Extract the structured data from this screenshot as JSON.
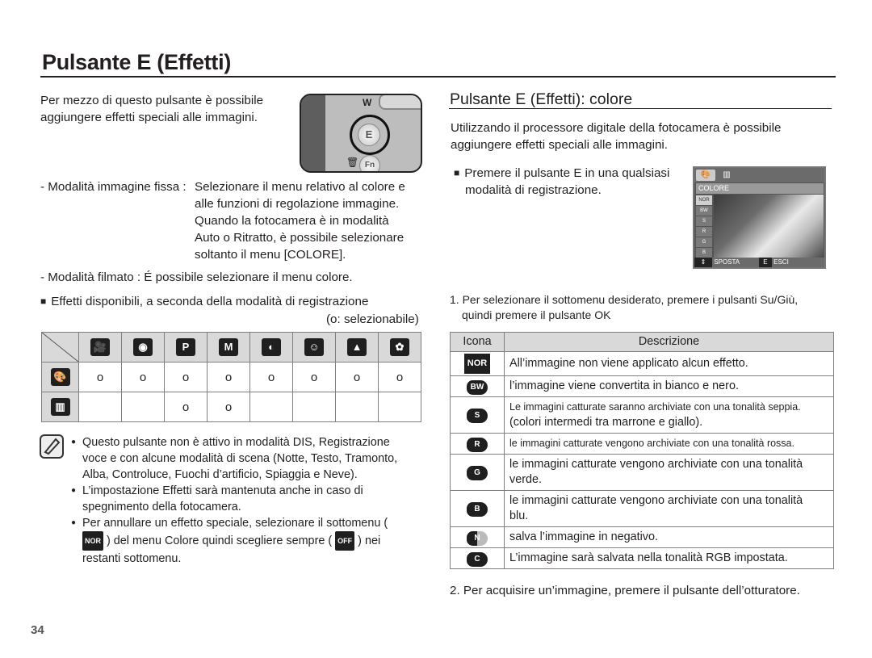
{
  "page_title": "Pulsante E (Effetti)",
  "left": {
    "intro": [
      "Per mezzo di questo pulsante è possibile",
      "aggiungere effetti speciali alle immagini."
    ],
    "camera_illustration": {
      "zoom_label": "W",
      "e_button": "E",
      "fn_button": "Fn"
    },
    "still_mode_label": "- Modalità immagine fissa :",
    "still_mode_lines": [
      "Selezionare il menu relativo al colore e",
      "alle funzioni di regolazione immagine.",
      "Quando la fotocamera è in modalità",
      "Auto o Ritratto, è possibile selezionare",
      "soltanto il menu [COLORE]."
    ],
    "movie_mode": "- Modalità filmato : É possibile selezionare il menu colore.",
    "availability_heading": "Effetti disponibili, a seconda della modalità di registrazione",
    "availability_legend": "(o: selezionabile)",
    "mode_table": {
      "columns": [
        {
          "icon": "movie-icon",
          "glyph": "🎥"
        },
        {
          "icon": "camera-auto-icon",
          "glyph": "◉"
        },
        {
          "icon": "camera-program-icon",
          "glyph": "P"
        },
        {
          "icon": "manual-icon",
          "glyph": "M"
        },
        {
          "icon": "dis-icon",
          "glyph": "◐"
        },
        {
          "icon": "portrait-icon",
          "glyph": "☺"
        },
        {
          "icon": "landscape-icon",
          "glyph": "▲"
        },
        {
          "icon": "macro-icon",
          "glyph": "✿"
        }
      ],
      "rows": [
        {
          "icon": "palette-icon",
          "glyph": "🎨",
          "cells": [
            "o",
            "o",
            "o",
            "o",
            "o",
            "o",
            "o",
            "o"
          ]
        },
        {
          "icon": "image-adjust-icon",
          "glyph": "▥",
          "cells": [
            "",
            "",
            "o",
            "o",
            "",
            "",
            "",
            ""
          ]
        }
      ]
    },
    "notes": [
      "Questo pulsante non è attivo in modalità DIS, Registrazione voce e con alcune modalità di scena (Notte, Testo, Tramonto, Alba, Controluce, Fuochi d’artificio, Spiaggia e Neve).",
      "L’impostazione Effetti sarà mantenuta anche in caso di spegnimento della fotocamera."
    ],
    "note3": {
      "part1": "Per annullare un effetto speciale, selezionare il sottomenu (",
      "icon1": "NOR",
      "part2": ") del menu Colore quindi scegliere sempre (",
      "icon2": "OFF",
      "part3": ") nei restanti sottomenu."
    }
  },
  "right": {
    "subtitle": "Pulsante E (Effetti): colore",
    "intro": [
      "Utilizzando il processore digitale della fotocamera è possibile",
      "aggiungere effetti speciali alle immagini."
    ],
    "step0": [
      "Premere il pulsante E in una qualsiasi",
      "modalità di registrazione."
    ],
    "lcd": {
      "menu_label": "COLORE",
      "side_items": [
        "NOR",
        "BW",
        "S",
        "R",
        "G",
        "B"
      ],
      "move_label": "SPOSTA",
      "exit_key": "E",
      "exit_label": "ESCI"
    },
    "step1": [
      "1. Per selezionare il sottomenu desiderato, premere i pulsanti Su/Giù,",
      "quindi premere il pulsante OK"
    ],
    "effects_table": {
      "headers": [
        "Icona",
        "Descrizione"
      ],
      "rows": [
        {
          "icon": "NOR",
          "desc": "All’immagine non viene applicato alcun effetto."
        },
        {
          "icon": "BW",
          "desc": "l’immagine viene convertita in bianco e nero."
        },
        {
          "icon": "S",
          "desc": "Le immagini catturate saranno archiviate con una tonalità seppia.",
          "desc2": "(colori intermedi tra marrone e giallo)."
        },
        {
          "icon": "R",
          "desc": "le immagini catturate vengono archiviate con una tonalità rossa."
        },
        {
          "icon": "G",
          "desc": "le immagini catturate vengono archiviate con una tonalità",
          "desc2": "verde."
        },
        {
          "icon": "B",
          "desc": "le immagini catturate vengono archiviate con una tonalità",
          "desc2": "blu."
        },
        {
          "icon": "N",
          "desc": "salva l’immagine in negativo."
        },
        {
          "icon": "C",
          "desc": "L’immagine sarà salvata nella tonalità RGB impostata."
        }
      ]
    },
    "step2": "2. Per acquisire un’immagine, premere il pulsante dell’otturatore."
  },
  "page_number": "34"
}
